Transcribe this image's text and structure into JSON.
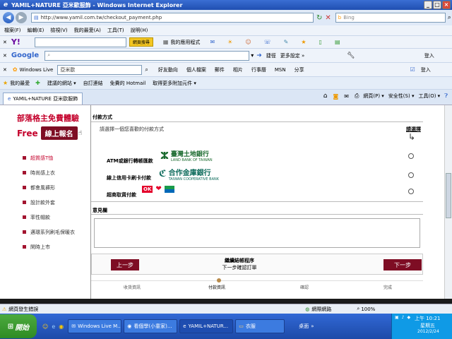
{
  "window": {
    "title": "YAMIL+NATURE 亞米歐服飾 - Windows Internet Explorer",
    "min_label": "_",
    "max_label": "□",
    "close_label": "×"
  },
  "address": {
    "url": "http://www.yamil.com.tw/checkout_payment.php",
    "search_placeholder": "Bing"
  },
  "menu": [
    "檔案(F)",
    "編輯(E)",
    "檢視(V)",
    "我的最愛(A)",
    "工具(T)",
    "說明(H)"
  ],
  "yahoo": {
    "logo": "Y!",
    "search_btn": "網頁搜尋",
    "apps_label": "我的應用程式"
  },
  "google": {
    "logo": "Google",
    "quick": "捷徑",
    "more": "更多設定 »",
    "login": "登入"
  },
  "live": {
    "brand": "Windows Live",
    "field": "亞米歐",
    "links": [
      "好友動向",
      "個人檔案",
      "郵件",
      "相片",
      "行事曆",
      "MSN",
      "分享"
    ],
    "login": "登入"
  },
  "fav": {
    "label": "我的最愛",
    "items": [
      "建議的網站 ▾",
      "自訂連結",
      "免費的 Hotmail",
      "取得更多附加元件 ▾"
    ]
  },
  "tab": {
    "title": "YAMIL+NATURE 亞米歐服飾",
    "tools": [
      "網頁(P) ▾",
      "安全性(S) ▾",
      "工具(O) ▾"
    ]
  },
  "sidebar": {
    "promo_line1": "部落格主免費體驗",
    "promo_free": "Free",
    "promo_btn": "線上報名",
    "categories": [
      {
        "label": "超質感T恤",
        "active": true
      },
      {
        "label": "時尚感上衣",
        "active": false
      },
      {
        "label": "都會風褲形",
        "active": false
      },
      {
        "label": "設計款外套",
        "active": false
      },
      {
        "label": "率性帽款",
        "active": false
      },
      {
        "label": "邁環系列刷毛保暖衣",
        "active": false
      },
      {
        "label": "閑時上市",
        "active": false
      }
    ]
  },
  "payment": {
    "section_title": "付款方式",
    "prompt": "請選擇一個您喜歡的付款方式",
    "choose_label": "請選擇",
    "options": [
      {
        "label": "ATM或銀行轉帳匯款",
        "bank": "臺灣土地銀行",
        "bank_en": "LAND BANK OF TAIWAN"
      },
      {
        "label": "線上信用卡刷卡付款",
        "bank": "合作金庫銀行",
        "bank_en": "TAIWAN COOPERATIVE BANK"
      },
      {
        "label": "超商取貨付款",
        "bank": "",
        "bank_en": ""
      }
    ]
  },
  "comments": {
    "title": "意見欄",
    "value": ""
  },
  "actions": {
    "prev": "上一步",
    "next": "下一步",
    "center_title": "繼續結帳程序",
    "center_sub": "下一步確認訂單"
  },
  "steps": [
    "收貨資訊",
    "付款資訊",
    "確認",
    "完成"
  ],
  "status": {
    "left": "網頁發生錯誤",
    "zone": "網際網路",
    "zoom": "100%"
  },
  "taskbar": {
    "start": "開始",
    "tasks": [
      "Windows Live M...",
      "看個學(小童家)...",
      "YAMIL+NATUR...",
      "衣服"
    ],
    "desktop": "桌面",
    "time": "上午 10:21",
    "weekday": "星期五",
    "date": "2012/2/24"
  },
  "colors": {
    "brand": "#7e0d24",
    "accent": "#c4002b",
    "taskbar": "#245edb"
  }
}
